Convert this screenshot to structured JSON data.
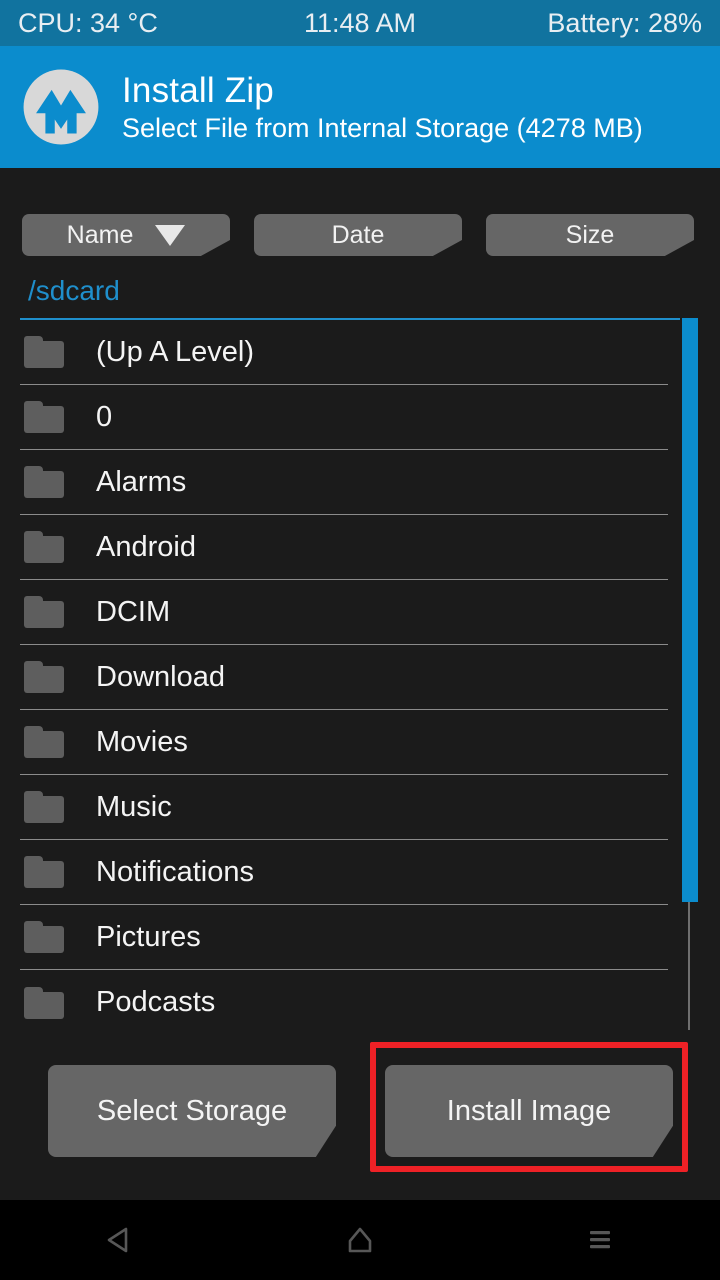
{
  "status_bar": {
    "cpu": "CPU: 34 °C",
    "time": "11:48 AM",
    "battery": "Battery: 28%"
  },
  "header": {
    "logo_icon": "twrp-logo-icon",
    "title": "Install Zip",
    "subtitle": "Select File from Internal Storage (4278 MB)"
  },
  "sort_bar": {
    "buttons": [
      {
        "label": "Name",
        "active": true,
        "arrow_icon": "sort-descending-triangle-icon"
      },
      {
        "label": "Date",
        "active": false
      },
      {
        "label": "Size",
        "active": false
      }
    ]
  },
  "path": "/sdcard",
  "file_list": {
    "rows": [
      {
        "name": "(Up A Level)",
        "icon": "folder-icon"
      },
      {
        "name": "0",
        "icon": "folder-icon"
      },
      {
        "name": "Alarms",
        "icon": "folder-icon"
      },
      {
        "name": "Android",
        "icon": "folder-icon"
      },
      {
        "name": "DCIM",
        "icon": "folder-icon"
      },
      {
        "name": "Download",
        "icon": "folder-icon"
      },
      {
        "name": "Movies",
        "icon": "folder-icon"
      },
      {
        "name": "Music",
        "icon": "folder-icon"
      },
      {
        "name": "Notifications",
        "icon": "folder-icon"
      },
      {
        "name": "Pictures",
        "icon": "folder-icon"
      },
      {
        "name": "Podcasts",
        "icon": "folder-icon"
      }
    ]
  },
  "actions": {
    "select_storage": "Select Storage",
    "install_image": "Install Image"
  },
  "annotation": {
    "target": "install_image",
    "color": "#ee2126"
  },
  "nav_bar": {
    "back_icon": "back-triangle-icon",
    "home_icon": "home-icon",
    "menu_icon": "menu-lines-icon"
  },
  "colors": {
    "status_bar_bg": "#11739f",
    "header_bg": "#0b8ccd",
    "accent_blue": "#1f8fcc",
    "page_bg": "#1b1b1b",
    "button_bg": "#666666",
    "folder_gray": "#5e5e5e",
    "annotation_red": "#ee2126"
  }
}
